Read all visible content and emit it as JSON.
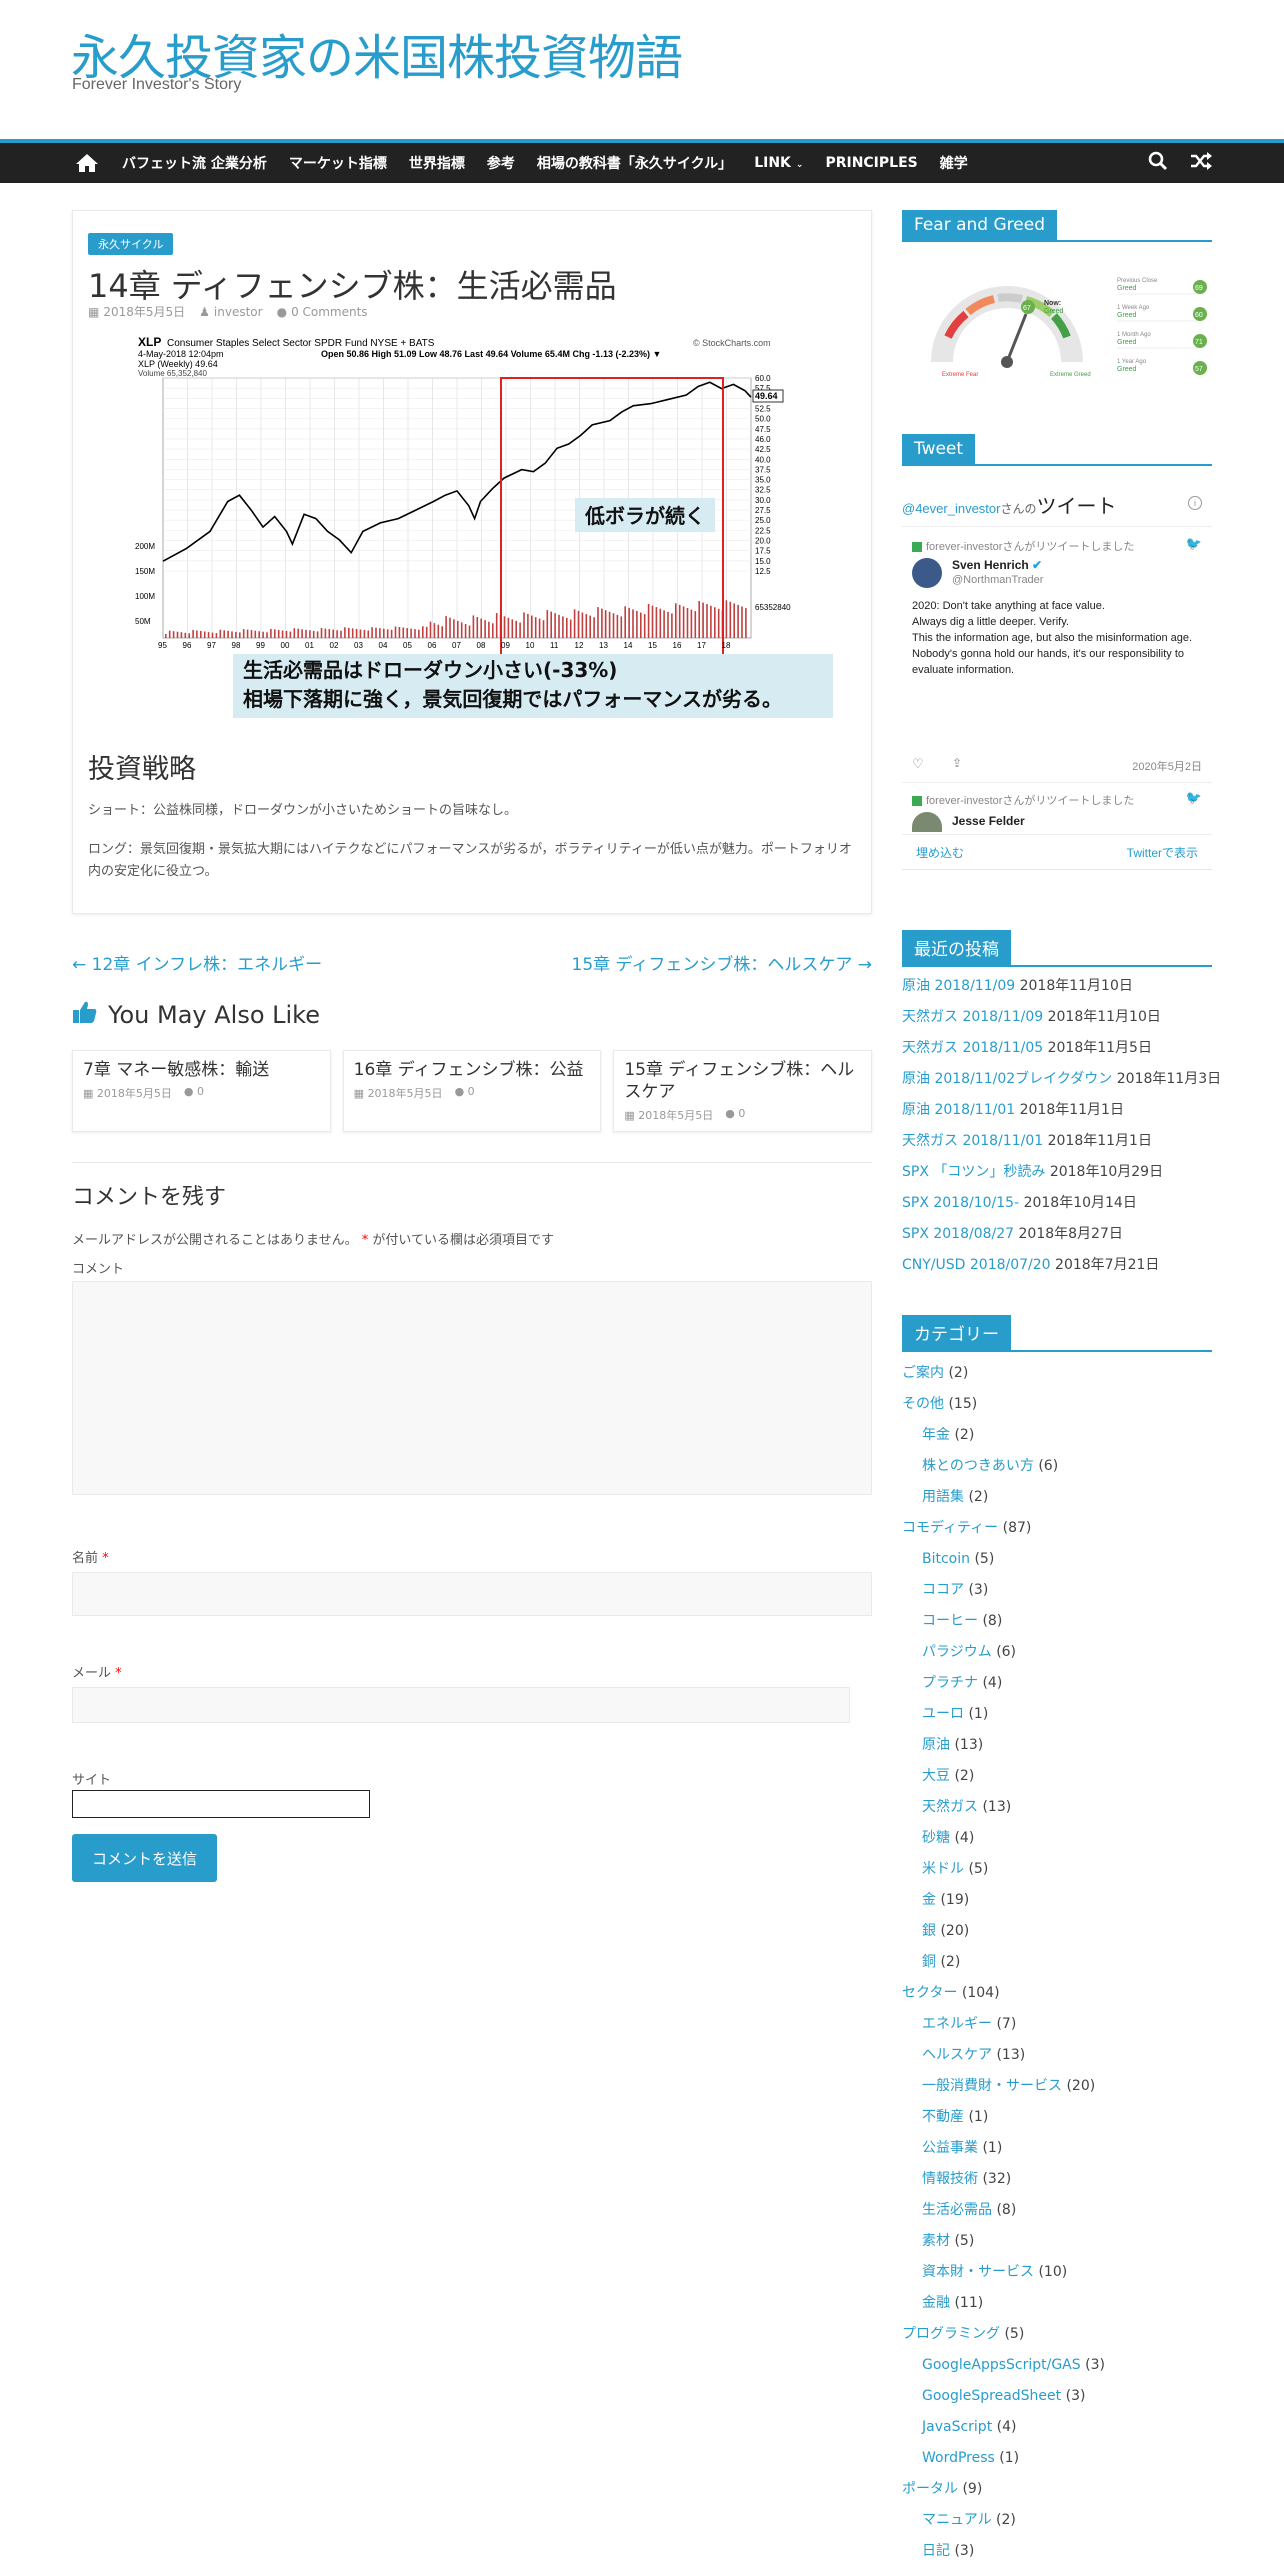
{
  "site": {
    "title": "永久投資家の米国株投資物語",
    "description": "Forever Investor's Story"
  },
  "nav": {
    "items": [
      "バフェット流 企業分析",
      "マーケット指標",
      "世界指標",
      "参考",
      "相場の教科書「永久サイクル」",
      "LINK",
      "PRINCIPLES",
      "雑学"
    ]
  },
  "post": {
    "category": "永久サイクル",
    "title": "14章 ディフェンシブ株：生活必需品",
    "date": "2018年5月5日",
    "author": "investor",
    "comments": "0 Comments",
    "section_heading": "投資戦略",
    "para1": "ショート：公益株同様，ドローダウンが小さいためショートの旨味なし。",
    "para2": "ロング：景気回復期・景気拡大期にはハイテクなどにパフォーマンスが劣るが，ボラティリティーが低い点が魅力。ポートフォリオ内の安定化に役立つ。"
  },
  "chart": {
    "header_ticker": "XLP",
    "header_name": "Consumer Staples Select Sector SPDR Fund NYSE + BATS",
    "header_source": "© StockCharts.com",
    "header_date": "4-May-2018 12:04pm",
    "header_ohlc": "Open 50.86  High 51.09  Low 48.76  Last 49.64  Volume 65.4M  Chg -1.13 (-2.23%) ▼",
    "legend_price": "XLP (Weekly) 49.64",
    "legend_volume": "Volume 65,352,840",
    "annotation_box": "低ボラが続く",
    "caption_line1": "生活必需品はドローダウン小さい(-33%)",
    "caption_line2": "相場下落期に強く，景気回復期ではパフォーマンスが劣る。",
    "last_price_label": "49.64",
    "last_volume_label": "65352840",
    "y_ticks": [
      "60.0",
      "57.5",
      "55.0",
      "52.5",
      "50.0",
      "47.5",
      "46.0",
      "42.5",
      "40.0",
      "37.5",
      "35.0",
      "32.5",
      "30.0",
      "27.5",
      "25.0",
      "22.5",
      "20.0",
      "17.5",
      "15.0",
      "12.5"
    ],
    "volume_ticks": [
      "200M",
      "150M",
      "100M",
      "50M"
    ],
    "x_ticks": [
      "95",
      "96",
      "97",
      "98",
      "99",
      "00",
      "01",
      "02",
      "03",
      "04",
      "05",
      "06",
      "07",
      "08",
      "09",
      "10",
      "11",
      "12",
      "13",
      "14",
      "15",
      "16",
      "17",
      "18"
    ]
  },
  "post_nav": {
    "prev": "← 12章 インフレ株：エネルギー",
    "next": "15章 ディフェンシブ株：ヘルスケア →"
  },
  "also": {
    "heading": "You May Also Like",
    "cards": [
      {
        "title": "7章 マネー敏感株：輸送",
        "date": "2018年5月5日",
        "comments": "0"
      },
      {
        "title": "16章 ディフェンシブ株：公益",
        "date": "2018年5月5日",
        "comments": "0"
      },
      {
        "title": "15章 ディフェンシブ株：ヘルスケア",
        "date": "2018年5月5日",
        "comments": "0"
      }
    ]
  },
  "comment_form": {
    "heading": "コメントを残す",
    "notice": "メールアドレスが公開されることはありません。",
    "notice_req": "が付いている欄は必須項目です",
    "comment_label": "コメント",
    "name_label": "名前",
    "email_label": "メール",
    "site_label": "サイト",
    "submit": "コメントを送信"
  },
  "sidebar": {
    "fg_title": "Fear and Greed",
    "fg": {
      "now_label": "Now:",
      "now_value": "Greed",
      "now_score": "67",
      "extreme_fear": "Extreme Fear",
      "extreme_greed": "Extreme Greed",
      "rows": [
        {
          "label": "Previous Close",
          "value": "Greed",
          "score": "69"
        },
        {
          "label": "1 Week Ago",
          "value": "Greed",
          "score": "60"
        },
        {
          "label": "1 Month Ago",
          "value": "Greed",
          "score": "71"
        },
        {
          "label": "1 Year Ago",
          "value": "Greed",
          "score": "57"
        }
      ]
    },
    "tweet_title": "Tweet",
    "tweet": {
      "handle": "@4ever_investor",
      "handle_suffix": "さんの",
      "heading": "ツイート",
      "rt1": "forever-investorさんがリツイートしました",
      "user_name": "Sven Henrich",
      "user_handle": "@NorthmanTrader",
      "body1": "2020: Don't take anything at face value.",
      "body2": "Always dig a little deeper. Verify.",
      "body3": "This the information age, but also the misinformation age.",
      "body4": "Nobody's gonna hold our hands, it's our responsibility to evaluate information.",
      "date": "2020年5月2日",
      "rt2": "forever-investorさんがリツイートしました",
      "user2_name": "Jesse Felder",
      "embed": "埋め込む",
      "view_on": "Twitterで表示"
    },
    "recent_title": "最近の投稿",
    "recent": [
      {
        "title": "原油 2018/11/09",
        "date": "2018年11月10日"
      },
      {
        "title": "天然ガス 2018/11/09",
        "date": "2018年11月10日"
      },
      {
        "title": "天然ガス 2018/11/05",
        "date": "2018年11月5日"
      },
      {
        "title": "原油 2018/11/02ブレイクダウン",
        "date": "2018年11月3日"
      },
      {
        "title": "原油 2018/11/01",
        "date": "2018年11月1日"
      },
      {
        "title": "天然ガス 2018/11/01",
        "date": "2018年11月1日"
      },
      {
        "title": "SPX 「コツン」秒読み",
        "date": "2018年10月29日"
      },
      {
        "title": "SPX 2018/10/15-",
        "date": "2018年10月14日"
      },
      {
        "title": "SPX 2018/08/27",
        "date": "2018年8月27日"
      },
      {
        "title": "CNY/USD 2018/07/20",
        "date": "2018年7月21日"
      }
    ],
    "cat_title": "カテゴリー",
    "cats": [
      {
        "name": "ご案内",
        "count": "(2)",
        "level": 0
      },
      {
        "name": "その他",
        "count": "(15)",
        "level": 0
      },
      {
        "name": "年金",
        "count": "(2)",
        "level": 1
      },
      {
        "name": "株とのつきあい方",
        "count": "(6)",
        "level": 1
      },
      {
        "name": "用語集",
        "count": "(2)",
        "level": 1
      },
      {
        "name": "コモディティー",
        "count": "(87)",
        "level": 0
      },
      {
        "name": "Bitcoin",
        "count": "(5)",
        "level": 1
      },
      {
        "name": "ココア",
        "count": "(3)",
        "level": 1
      },
      {
        "name": "コーヒー",
        "count": "(8)",
        "level": 1
      },
      {
        "name": "パラジウム",
        "count": "(6)",
        "level": 1
      },
      {
        "name": "プラチナ",
        "count": "(4)",
        "level": 1
      },
      {
        "name": "ユーロ",
        "count": "(1)",
        "level": 1
      },
      {
        "name": "原油",
        "count": "(13)",
        "level": 1
      },
      {
        "name": "大豆",
        "count": "(2)",
        "level": 1
      },
      {
        "name": "天然ガス",
        "count": "(13)",
        "level": 1
      },
      {
        "name": "砂糖",
        "count": "(4)",
        "level": 1
      },
      {
        "name": "米ドル",
        "count": "(5)",
        "level": 1
      },
      {
        "name": "金",
        "count": "(19)",
        "level": 1
      },
      {
        "name": "銀",
        "count": "(20)",
        "level": 1
      },
      {
        "name": "銅",
        "count": "(2)",
        "level": 1
      },
      {
        "name": "セクター",
        "count": "(104)",
        "level": 0
      },
      {
        "name": "エネルギー",
        "count": "(7)",
        "level": 1
      },
      {
        "name": "ヘルスケア",
        "count": "(13)",
        "level": 1
      },
      {
        "name": "一般消費財・サービス",
        "count": "(20)",
        "level": 1
      },
      {
        "name": "不動産",
        "count": "(1)",
        "level": 1
      },
      {
        "name": "公益事業",
        "count": "(1)",
        "level": 1
      },
      {
        "name": "情報技術",
        "count": "(32)",
        "level": 1
      },
      {
        "name": "生活必需品",
        "count": "(8)",
        "level": 1
      },
      {
        "name": "素材",
        "count": "(5)",
        "level": 1
      },
      {
        "name": "資本財・サービス",
        "count": "(10)",
        "level": 1
      },
      {
        "name": "金融",
        "count": "(11)",
        "level": 1
      },
      {
        "name": "プログラミング",
        "count": "(5)",
        "level": 0
      },
      {
        "name": "GoogleAppsScript/GAS",
        "count": "(3)",
        "level": 1
      },
      {
        "name": "GoogleSpreadSheet",
        "count": "(3)",
        "level": 1
      },
      {
        "name": "JavaScript",
        "count": "(4)",
        "level": 1
      },
      {
        "name": "WordPress",
        "count": "(1)",
        "level": 1
      },
      {
        "name": "ポータル",
        "count": "(9)",
        "level": 0
      },
      {
        "name": "マニュアル",
        "count": "(2)",
        "level": 1
      },
      {
        "name": "日記",
        "count": "(3)",
        "level": 1
      }
    ]
  },
  "colors": {
    "accent": "#289dcc",
    "nav_bg": "#222222",
    "price_line": "#000000",
    "highlight_box": "#dd2222",
    "caption_bg": "#d6ebf2",
    "volume": "#c04040",
    "greed": "#6ab04c"
  }
}
